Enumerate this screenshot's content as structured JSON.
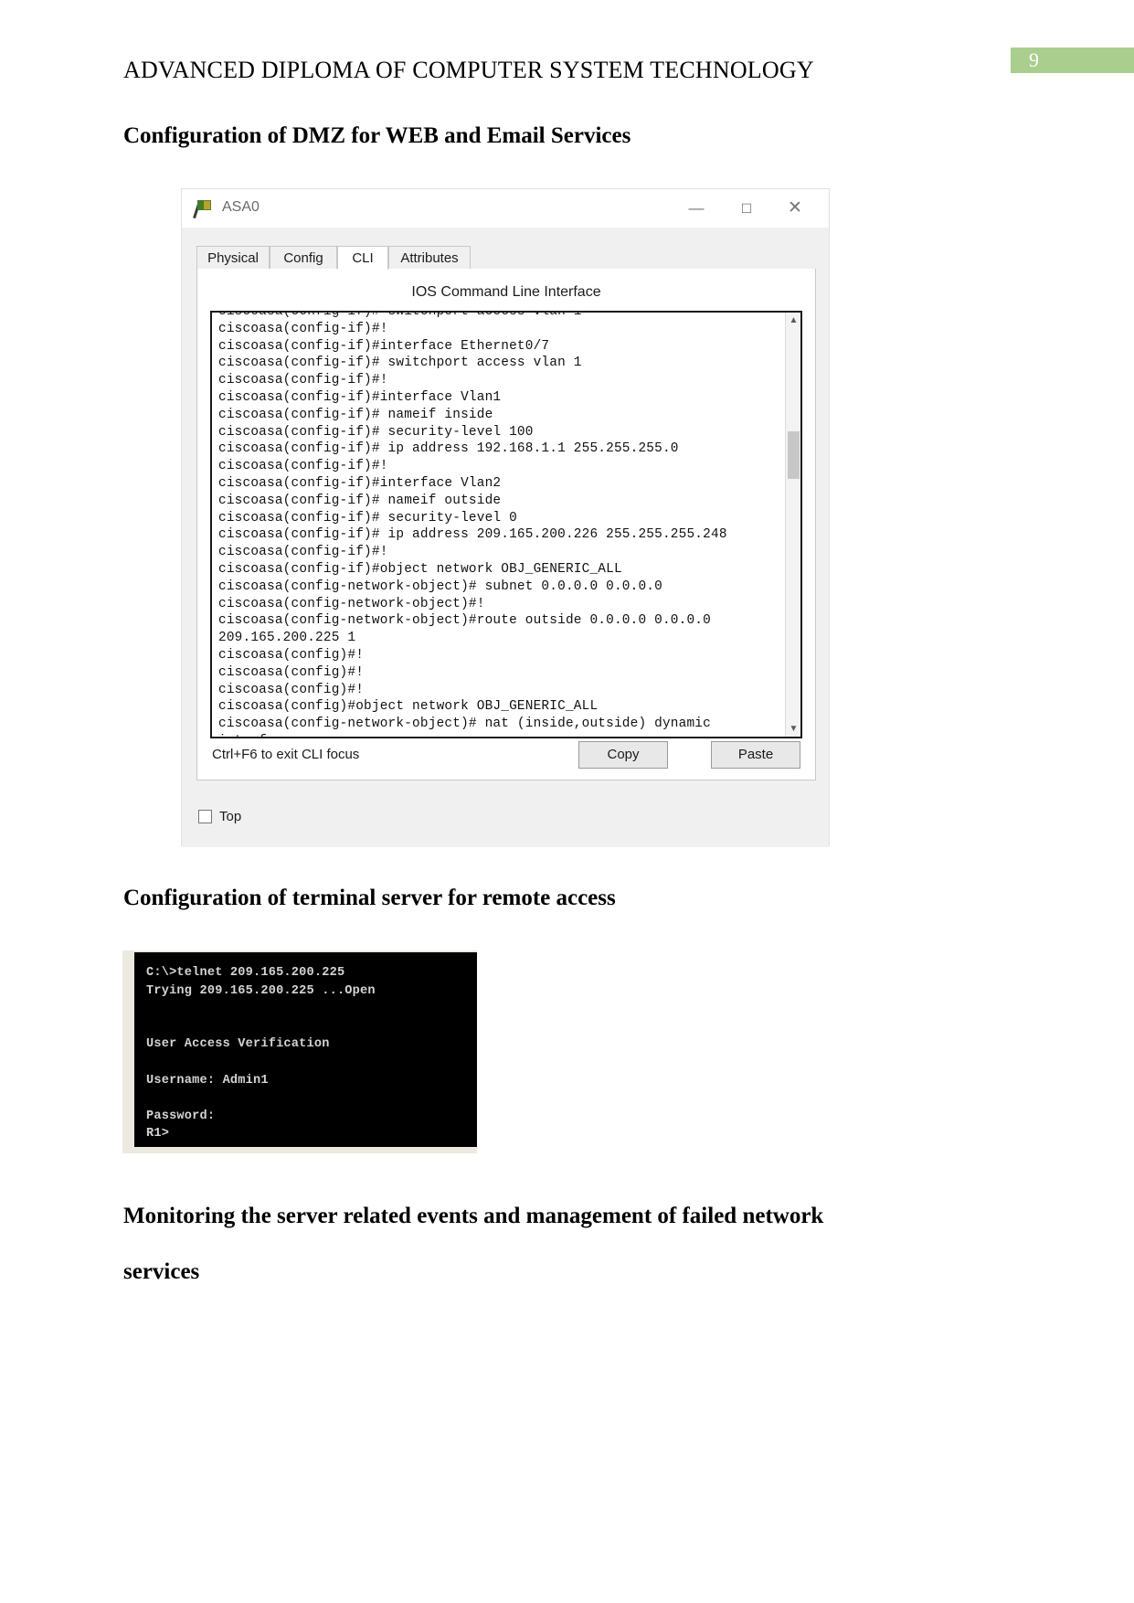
{
  "page": {
    "doc_title": "ADVANCED DIPLOMA OF COMPUTER SYSTEM TECHNOLOGY",
    "page_number": "9",
    "badge_color": "#a9ce8e"
  },
  "headings": {
    "dmz": "Configuration of DMZ for WEB and Email Services",
    "terminal": "Configuration of terminal server for remote access",
    "monitoring_line1": "Monitoring the server related events and management of failed network",
    "monitoring_line2": "services"
  },
  "asa_window": {
    "title": "ASA0",
    "icon": "packet-tracer-flag-icon",
    "window_controls": {
      "minimize": "—",
      "maximize": "☐",
      "close": "✕"
    },
    "tabs": [
      {
        "label": "Physical",
        "active": false
      },
      {
        "label": "Config",
        "active": false
      },
      {
        "label": "CLI",
        "active": true
      },
      {
        "label": "Attributes",
        "active": false
      }
    ],
    "cli_caption": "IOS Command Line Interface",
    "cli_text": "ciscoasa(config-if)# switchport access vlan 1\nciscoasa(config-if)#!\nciscoasa(config-if)#interface Ethernet0/7\nciscoasa(config-if)# switchport access vlan 1\nciscoasa(config-if)#!\nciscoasa(config-if)#interface Vlan1\nciscoasa(config-if)# nameif inside\nciscoasa(config-if)# security-level 100\nciscoasa(config-if)# ip address 192.168.1.1 255.255.255.0\nciscoasa(config-if)#!\nciscoasa(config-if)#interface Vlan2\nciscoasa(config-if)# nameif outside\nciscoasa(config-if)# security-level 0\nciscoasa(config-if)# ip address 209.165.200.226 255.255.255.248\nciscoasa(config-if)#!\nciscoasa(config-if)#object network OBJ_GENERIC_ALL\nciscoasa(config-network-object)# subnet 0.0.0.0 0.0.0.0\nciscoasa(config-network-object)#!\nciscoasa(config-network-object)#route outside 0.0.0.0 0.0.0.0\n209.165.200.225 1\nciscoasa(config)#!\nciscoasa(config)#!\nciscoasa(config)#!\nciscoasa(config)#object network OBJ_GENERIC_ALL\nciscoasa(config-network-object)# nat (inside,outside) dynamic\ninterface",
    "scroll_up_arrow": "▲",
    "scroll_down_arrow": "▼",
    "hint": "Ctrl+F6 to exit CLI focus",
    "copy_label": "Copy",
    "paste_label": "Paste",
    "top_label": "Top"
  },
  "telnet": {
    "text": "C:\\>telnet 209.165.200.225\nTrying 209.165.200.225 ...Open\n\n\nUser Access Verification\n\nUsername: Admin1\n\nPassword:\nR1>"
  }
}
